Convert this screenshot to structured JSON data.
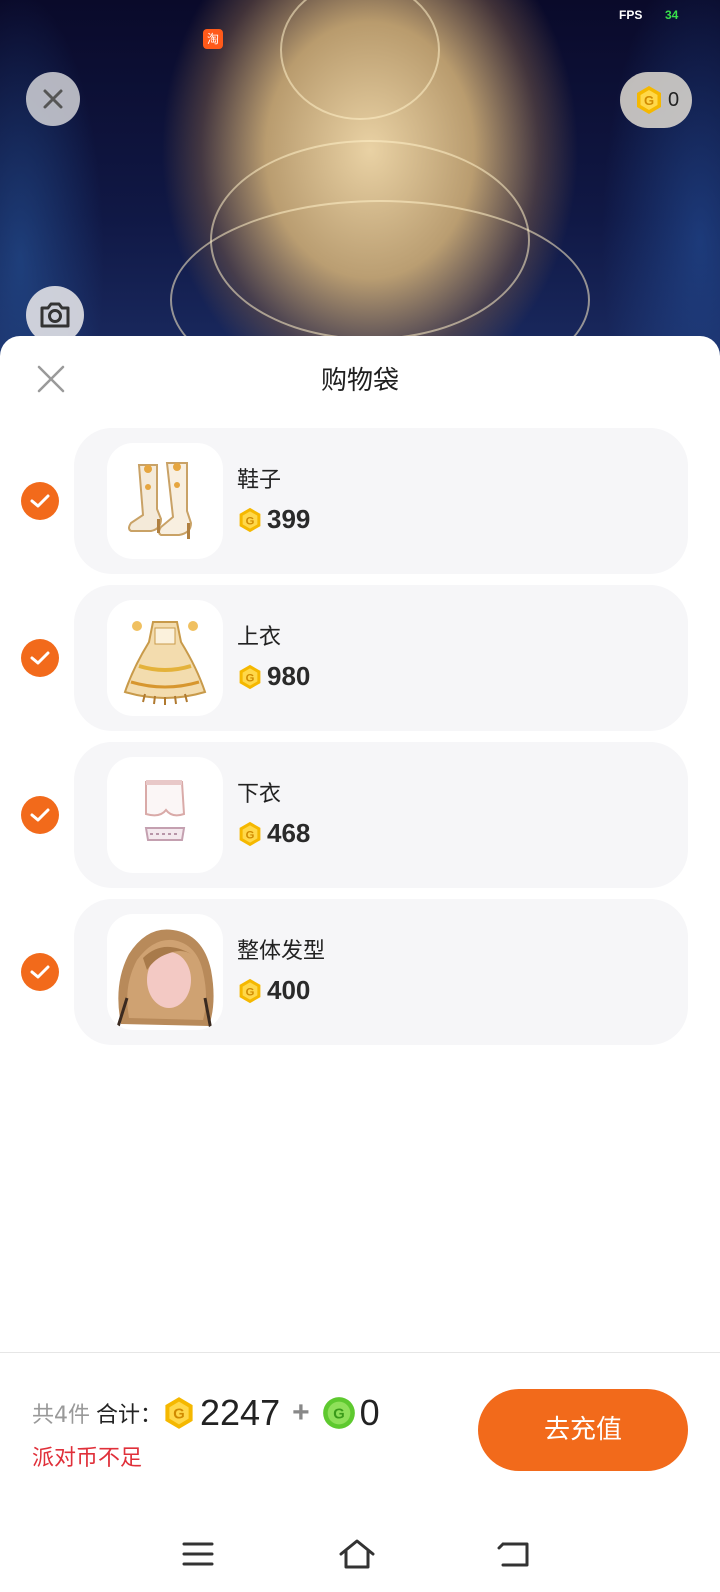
{
  "status": {
    "fps_label": "FPS",
    "fps_value": "34",
    "taobao_glyph": "淘"
  },
  "scene": {
    "coin_count": "0"
  },
  "sheet": {
    "title": "购物袋"
  },
  "items": [
    {
      "name": "鞋子",
      "price": "399",
      "icon": "boots-thumbnail"
    },
    {
      "name": "上衣",
      "price": "980",
      "icon": "dress-top-thumbnail"
    },
    {
      "name": "下衣",
      "price": "468",
      "icon": "bottoms-thumbnail"
    },
    {
      "name": "整体发型",
      "price": "400",
      "icon": "hairstyle-thumbnail"
    }
  ],
  "footer": {
    "count_label": "共4件",
    "total_label": "合计：",
    "gold_total": "2247",
    "plus": "+",
    "green_total": "0",
    "warning": "派对币不足",
    "recharge_label": "去充值"
  },
  "colors": {
    "accent": "#f26a1b",
    "gold_coin": "#f5b800",
    "green_coin": "#5ec92f",
    "warning": "#e0303a"
  }
}
